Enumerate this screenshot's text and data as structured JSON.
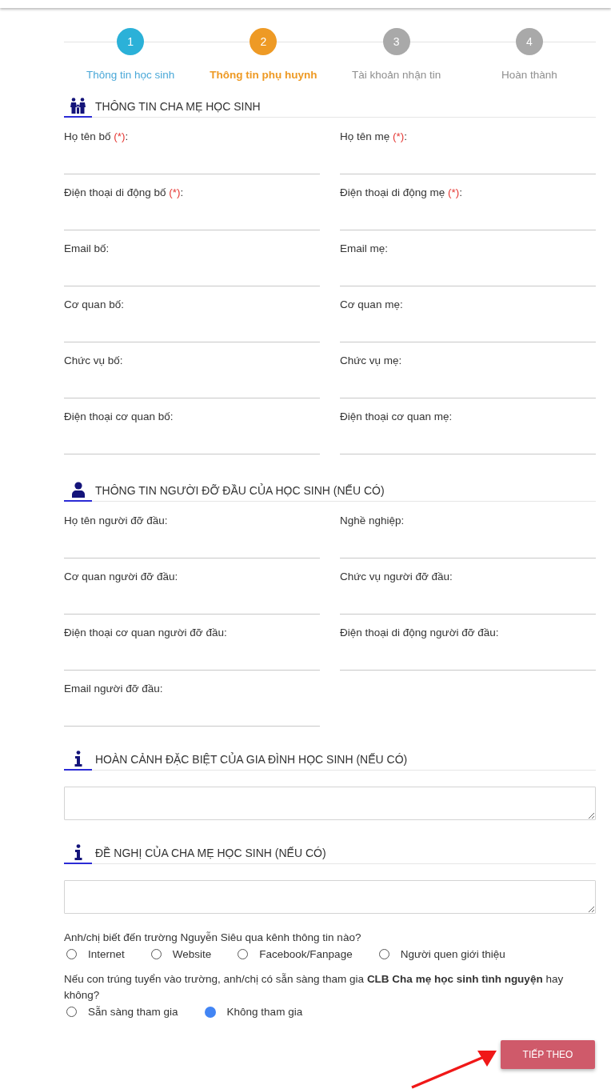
{
  "steps": [
    {
      "number": "1",
      "label": "Thông tin học sinh",
      "completed": true,
      "selected": false
    },
    {
      "number": "2",
      "label": "Thông tin phụ huynh",
      "completed": false,
      "selected": true
    },
    {
      "number": "3",
      "label": "Tài khoản nhận tin",
      "completed": false,
      "selected": false
    },
    {
      "number": "4",
      "label": "Hoàn thành",
      "completed": false,
      "selected": false
    }
  ],
  "sections": [
    {
      "kind": "fields",
      "title": "THÔNG TIN CHA MẸ HỌC SINH",
      "fields": [
        {
          "label": "Họ tên bố",
          "required": "(*)",
          "label_end": ":"
        },
        {
          "label": "Họ tên mẹ",
          "required": "(*)",
          "label_end": ":"
        },
        {
          "label": "Điện thoại di động bố",
          "required": "(*)",
          "label_end": ":"
        },
        {
          "label": "Điện thoại di động mẹ",
          "required": "(*)",
          "label_end": ":"
        },
        {
          "label": "Email bố:"
        },
        {
          "label": "Email mẹ:"
        },
        {
          "label": "Cơ quan bố:"
        },
        {
          "label": "Cơ quan mẹ:"
        },
        {
          "label": "Chức vụ bố:"
        },
        {
          "label": "Chức vụ mẹ:"
        },
        {
          "label": "Điện thoại cơ quan bố:"
        },
        {
          "label": "Điện thoại cơ quan mẹ:"
        }
      ]
    },
    {
      "kind": "fields",
      "title": "THÔNG TIN NGƯỜI ĐỠ ĐẦU CỦA HỌC SINH (NẾU CÓ)",
      "fields": [
        {
          "label": "Họ tên người đỡ đầu:"
        },
        {
          "label": "Nghề nghiệp:"
        },
        {
          "label": "Cơ quan người đỡ đầu:"
        },
        {
          "label": "Chức vụ người đỡ đầu:"
        },
        {
          "label": "Điện thoại cơ quan người đỡ đầu:"
        },
        {
          "label": "Điện thoại di động người đỡ đầu:"
        },
        {
          "label": "Email người đỡ đầu:"
        }
      ]
    },
    {
      "kind": "textarea",
      "title": "HOÀN CẢNH ĐẶC BIỆT CỦA GIA ĐÌNH HỌC SINH (NẾU CÓ)"
    },
    {
      "kind": "textarea",
      "title": "ĐỀ NGHỊ CỦA CHA MẸ HỌC SINH (NẾU CÓ)"
    }
  ],
  "questions": [
    {
      "text": "Anh/chị biết đến trường Nguyễn Siêu qua kênh thông tin nào?",
      "options": [
        {
          "label": "Internet",
          "selected": false
        },
        {
          "label": "Website",
          "selected": false
        },
        {
          "label": "Facebook/Fanpage",
          "selected": false
        },
        {
          "label": "Người quen giới thiệu",
          "selected": false
        }
      ]
    },
    {
      "text": "Nếu con trúng tuyển vào trường, anh/chị có sẵn sàng tham gia **CLB Cha mẹ học sinh tình nguyện** hay không?",
      "options": [
        {
          "label": "Sẵn sàng tham gia",
          "selected": false
        },
        {
          "label": "Không tham gia",
          "selected": true
        }
      ]
    }
  ],
  "next_button": "TIẾP THEO"
}
